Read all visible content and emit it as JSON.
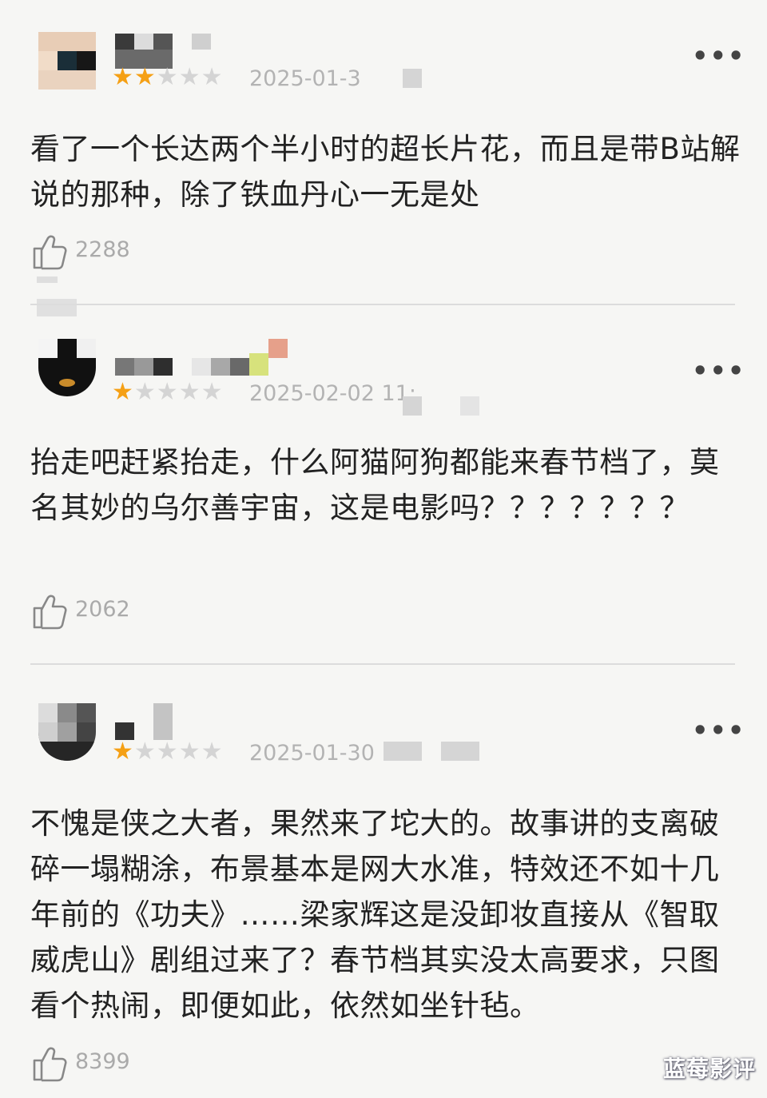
{
  "comments": [
    {
      "rating_filled": 2,
      "stars_filled": "★★",
      "stars_empty": "★★★",
      "date": "2025-01-3",
      "text": "看了一个长达两个半小时的超长片花，而且是带B站解说的那种，除了铁血丹心一无是处",
      "likes": "2288",
      "more_label": "•••"
    },
    {
      "rating_filled": 1,
      "stars_filled": "★",
      "stars_empty": "★★★★",
      "date": "2025-02-02 11:",
      "text": "抬走吧赶紧抬走，什么阿猫阿狗都能来春节档了，莫名其妙的乌尔善宇宙，这是电影吗？？？？？？？",
      "likes": "2062",
      "more_label": "•••"
    },
    {
      "rating_filled": 1,
      "stars_filled": "★",
      "stars_empty": "★★★★",
      "date": "2025-01-30",
      "text": "不愧是侠之大者，果然来了坨大的。故事讲的支离破碎一塌糊涂，布景基本是网大水准，特效还不如十几年前的《功夫》……梁家辉这是没卸妆直接从《智取威虎山》剧组过来了？春节档其实没太高要求，只图看个热闹，即便如此，依然如坐针毡。",
      "likes": "8399",
      "more_label": "•••"
    }
  ],
  "watermark": "蓝莓影评",
  "colors": {
    "star_on": "#f5a015",
    "star_off": "#d4d4d4",
    "meta_text": "#b3b3b3",
    "body_text": "#222222",
    "background": "#f6f6f4"
  },
  "icons": [
    "thumbs-up-icon",
    "more-options-icon",
    "star-icon"
  ]
}
